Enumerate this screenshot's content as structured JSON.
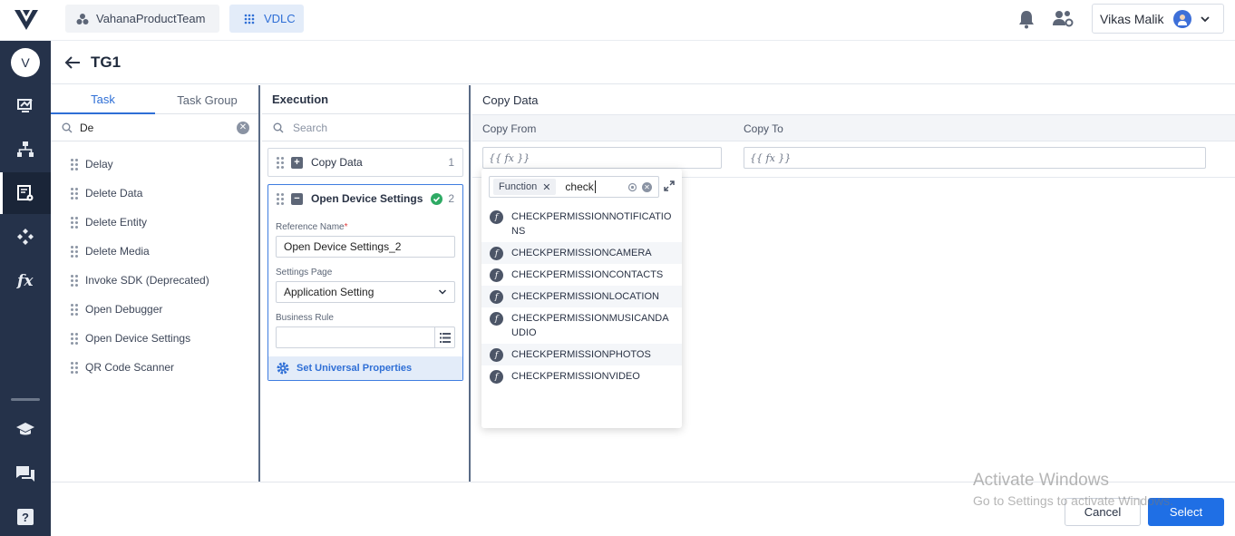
{
  "topbar": {
    "team_name": "VahanaProductTeam",
    "app_name": "VDLC",
    "user_name": "Vikas Malik",
    "accent_color": "#2f6fd6"
  },
  "rail": {
    "avatar_initial": "V",
    "icons": [
      "dashboard-icon",
      "flow-diagram-icon",
      "task-settings-icon",
      "integrations-icon",
      "function-icon",
      "learning-icon",
      "chat-icon",
      "help-icon"
    ]
  },
  "page": {
    "title": "TG1"
  },
  "task_panel": {
    "tabs": [
      "Task",
      "Task Group"
    ],
    "search_value": "De",
    "items": [
      "Delay",
      "Delete Data",
      "Delete Entity",
      "Delete Media",
      "Invoke SDK (Deprecated)",
      "Open Debugger",
      "Open Device Settings",
      "QR Code Scanner"
    ]
  },
  "execution": {
    "title": "Execution",
    "search_placeholder": "Search",
    "cards": [
      {
        "name": "Copy Data",
        "index": "1"
      },
      {
        "name": "Open Device Settings",
        "index": "2"
      }
    ],
    "reference_label": "Reference Name",
    "reference_value": "Open Device Settings_2",
    "settings_label": "Settings Page",
    "settings_value": "Application Setting",
    "business_rule_label": "Business Rule",
    "universal_label": "Set Universal Properties"
  },
  "copy_data": {
    "title": "Copy Data",
    "from_label": "Copy From",
    "to_label": "Copy To",
    "from_placeholder": "{{ fx }}",
    "to_placeholder": "{{ fx }}"
  },
  "function_popup": {
    "tag": "Function",
    "query": "check",
    "results": [
      "CHECKPERMISSIONNOTIFICATIONS",
      "CHECKPERMISSIONCAMERA",
      "CHECKPERMISSIONCONTACTS",
      "CHECKPERMISSIONLOCATION",
      "CHECKPERMISSIONMUSICANDAUDIO",
      "CHECKPERMISSIONPHOTOS",
      "CHECKPERMISSIONVIDEO"
    ]
  },
  "footer": {
    "cancel_label": "Cancel",
    "select_label": "Select"
  },
  "watermark": {
    "line1": "Activate Windows",
    "line2": "Go to Settings to activate Windows."
  }
}
